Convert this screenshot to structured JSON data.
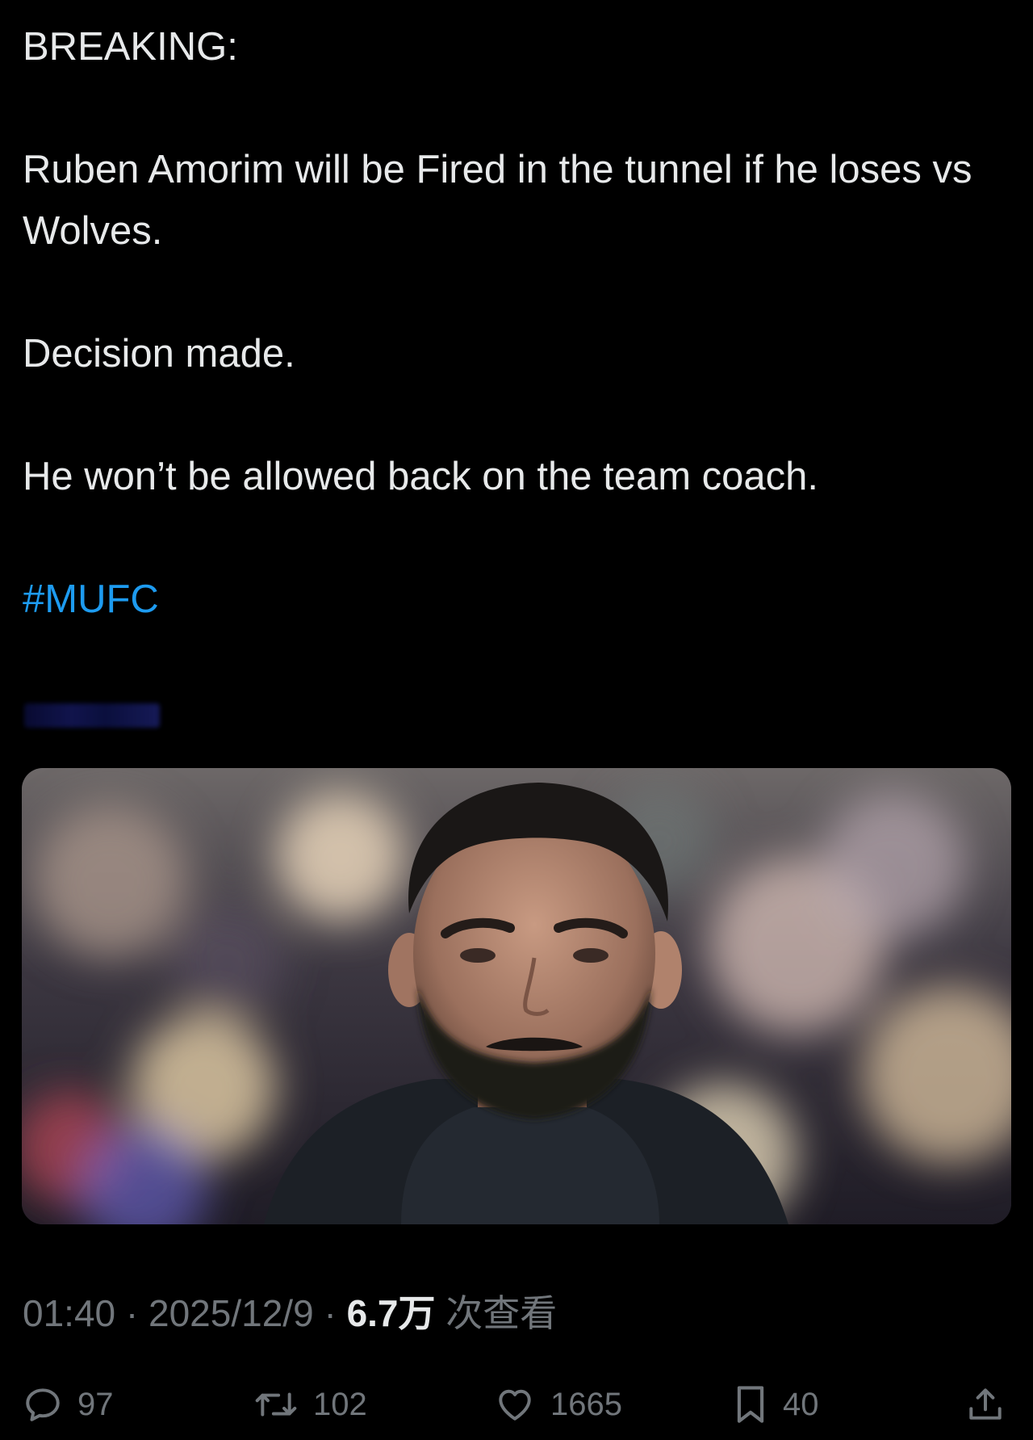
{
  "tweet": {
    "line_breaking": "BREAKING:",
    "line_main": "Ruben Amorim will be Fired in the tunnel if he loses vs Wolves.",
    "line_decision": "Decision made.",
    "line_coach": "He won’t be allowed back on the team coach.",
    "hashtag": "#MUFC"
  },
  "meta": {
    "time": "01:40",
    "separator": "·",
    "date": "2025/12/9",
    "views_count": "6.7万",
    "views_label": "次查看"
  },
  "actions": {
    "reply_count": "97",
    "retweet_count": "102",
    "like_count": "1665",
    "bookmark_count": "40"
  },
  "colors": {
    "background": "#000000",
    "text": "#e7e9ea",
    "secondary_text": "#71767b",
    "hashtag": "#1d9bf0"
  },
  "icons": [
    "reply-icon",
    "retweet-icon",
    "like-icon",
    "bookmark-icon",
    "share-icon"
  ]
}
